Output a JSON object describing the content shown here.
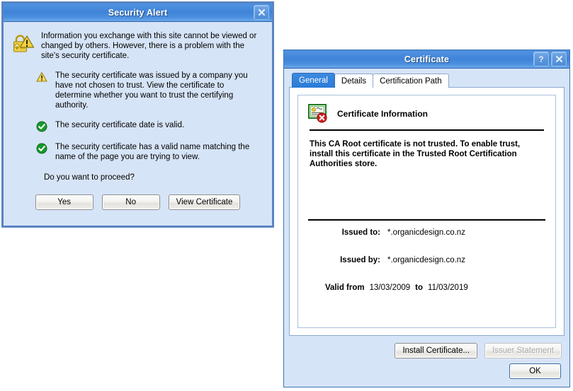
{
  "security_alert": {
    "title": "Security Alert",
    "close_label": "×",
    "icon": "lock-warning-icon",
    "intro": "Information you exchange with this site cannot be viewed or changed by others. However, there is a problem with the site's security certificate.",
    "bullets": [
      {
        "icon": "warning-triangle-icon",
        "text": "The security certificate was issued by a company you have not chosen to trust. View the certificate to determine whether you want to trust the certifying authority."
      },
      {
        "icon": "green-check-icon",
        "text": "The security certificate date is valid."
      },
      {
        "icon": "green-check-icon",
        "text": "The security certificate has a valid name matching the name of the page you are trying to view."
      }
    ],
    "question": "Do you want to proceed?",
    "buttons": {
      "yes": "Yes",
      "no": "No",
      "view_certificate": "View Certificate"
    }
  },
  "certificate": {
    "title": "Certificate",
    "help_label": "?",
    "close_label": "×",
    "tabs": [
      {
        "label": "General",
        "active": true
      },
      {
        "label": "Details",
        "active": false
      },
      {
        "label": "Certification Path",
        "active": false
      }
    ],
    "info_icon": "certificate-seal-error-icon",
    "info_heading": "Certificate Information",
    "notice": "This CA Root certificate is not trusted. To enable trust, install this certificate in the Trusted Root Certification Authorities store.",
    "fields": {
      "issued_to_label": "Issued to:",
      "issued_to_value": "*.organicdesign.co.nz",
      "issued_by_label": "Issued by:",
      "issued_by_value": "*.organicdesign.co.nz",
      "valid_from_label": "Valid from",
      "valid_from_value": "13/03/2009",
      "valid_to_label": "to",
      "valid_to_value": "11/03/2019"
    },
    "buttons": {
      "install_certificate": "Install Certificate...",
      "issuer_statement": "Issuer Statement",
      "ok": "OK"
    }
  },
  "colors": {
    "titlebar_blue": "#3f83d8",
    "dialog_body": "#d6e4f7",
    "tab_active": "#2b7bd6",
    "check_green": "#1e9e30",
    "warn_yellow": "#f7d73c",
    "error_red": "#d32020"
  }
}
